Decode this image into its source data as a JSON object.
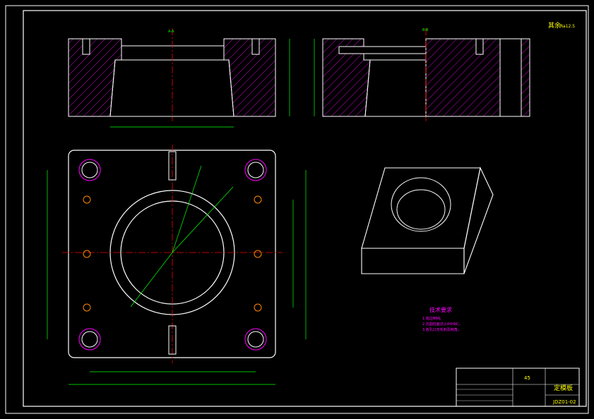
{
  "corner_note": "其余",
  "corner_roughness": "Ra12.5",
  "section_label_left": "A-A",
  "section_label_right": "B-B",
  "tech_requirements": {
    "title": "技术要求",
    "lines": [
      "1.锐边倒钝。",
      "2.内圆柱面淬火45HRC。",
      "3.各孔口无毛刺及倒角。"
    ]
  },
  "title_block": {
    "part_name": "定模板",
    "material": "45",
    "drawing_number": "JDZ01-02"
  },
  "colors": {
    "outline": "#ffffff",
    "centerline": "#ff0000",
    "dimension": "#00ff00",
    "hatch": "#ff00ff",
    "text_accent": "#ffff00",
    "hidden": "#00ffff"
  }
}
